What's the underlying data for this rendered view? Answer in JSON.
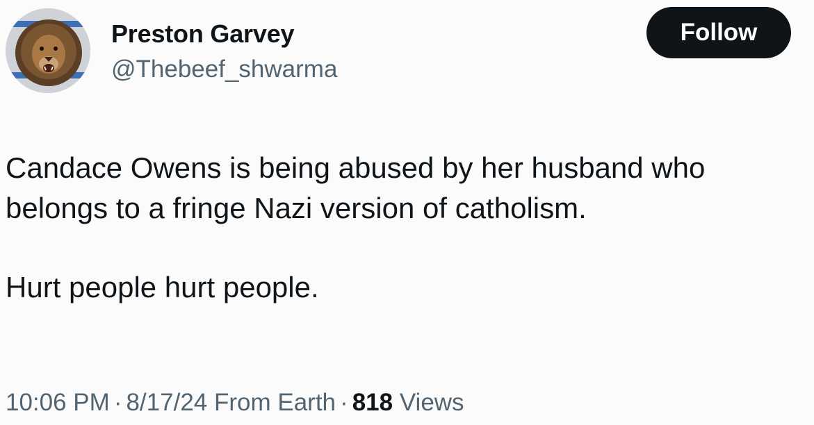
{
  "author": {
    "name": "Preston Garvey",
    "handle": "@Thebeef_shwarma",
    "avatar_icon": "lion-avatar-icon"
  },
  "follow_label": "Follow",
  "tweet": {
    "line1": "Candace Owens is being abused by her husband who",
    "line2": "belongs to a fringe Nazi version of catholism.",
    "line3": "Hurt people hurt people."
  },
  "meta": {
    "time": "10:06 PM",
    "date": "8/17/24",
    "source": "From Earth",
    "separator": "·",
    "views_count": "818",
    "views_label": "Views"
  },
  "colors": {
    "text_primary": "#0f1419",
    "text_secondary": "#536471",
    "button_bg": "#0f1419",
    "button_text": "#ffffff"
  }
}
